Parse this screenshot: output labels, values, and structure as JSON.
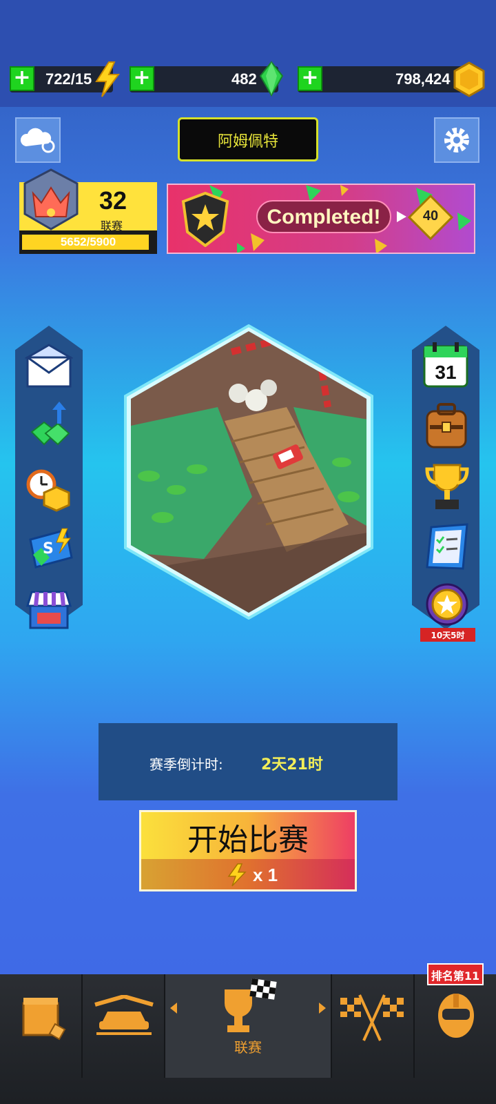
{
  "resources": {
    "energy": "722/15",
    "gems": "482",
    "coins": "798,424"
  },
  "location_title": "阿姆佩特",
  "league": {
    "level": "32",
    "label": "联赛",
    "progress_text": "5652/5900",
    "progress_fraction": 0.958
  },
  "banner": {
    "status": "Completed!",
    "reward": "40"
  },
  "right_panel": {
    "calendar_day": "31",
    "event_timer": "10天5时"
  },
  "season": {
    "label": "赛季倒计时:",
    "value": "2天21时"
  },
  "start_button": {
    "label": "开始比赛",
    "cost": "x 1"
  },
  "bottom_nav": {
    "active_label": "联赛",
    "rank_badge": "排名第11"
  },
  "colors": {
    "accent_green": "#1fd41f",
    "title_yellow": "#e8e53a",
    "nav_orange": "#f0a030"
  }
}
